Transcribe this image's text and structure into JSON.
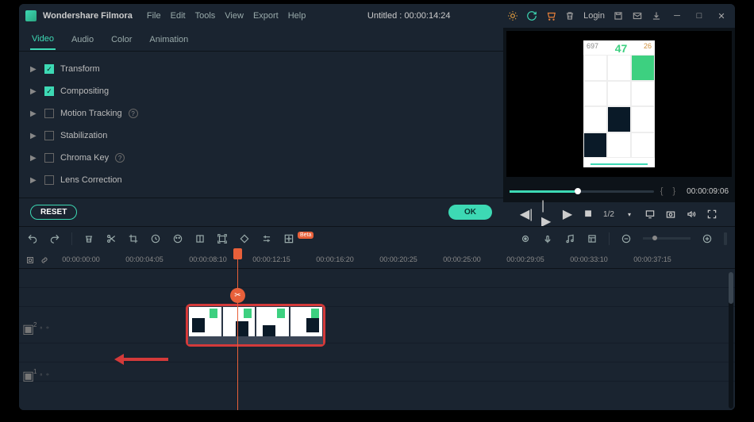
{
  "app": {
    "title": "Wondershare Filmora",
    "doc_title": "Untitled : 00:00:14:24"
  },
  "menus": [
    "File",
    "Edit",
    "Tools",
    "View",
    "Export",
    "Help"
  ],
  "login": "Login",
  "tabs": [
    {
      "label": "Video",
      "active": true
    },
    {
      "label": "Audio",
      "active": false
    },
    {
      "label": "Color",
      "active": false
    },
    {
      "label": "Animation",
      "active": false
    }
  ],
  "props": [
    {
      "label": "Transform",
      "checked": true,
      "help": false
    },
    {
      "label": "Compositing",
      "checked": true,
      "help": false
    },
    {
      "label": "Motion Tracking",
      "checked": false,
      "help": true
    },
    {
      "label": "Stabilization",
      "checked": false,
      "help": false
    },
    {
      "label": "Chroma Key",
      "checked": false,
      "help": true
    },
    {
      "label": "Lens Correction",
      "checked": false,
      "help": false
    }
  ],
  "buttons": {
    "reset": "RESET",
    "ok": "OK"
  },
  "preview": {
    "score_left": "697",
    "score_center": "47",
    "score_right": "26"
  },
  "playback": {
    "time": "00:00:09:06",
    "speed": "1/2"
  },
  "toolbar": {
    "beta": "Beta"
  },
  "ruler": [
    "00:00:00:00",
    "00:00:04:05",
    "00:00:08:10",
    "00:00:12:15",
    "00:00:16:20",
    "00:00:20:25",
    "00:00:25:00",
    "00:00:29:05",
    "00:00:33:10",
    "00:00:37:15"
  ],
  "track_labels": {
    "t2": "2",
    "t1": "1"
  }
}
